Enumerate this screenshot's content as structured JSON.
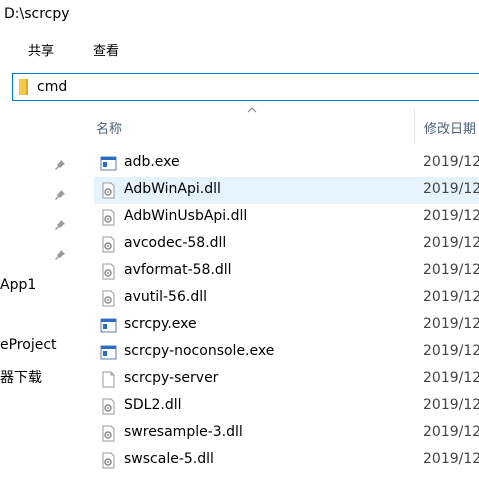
{
  "window": {
    "title": "D:\\scrcpy"
  },
  "ribbon": {
    "tabs": [
      "共享",
      "查看"
    ]
  },
  "address": {
    "value": "cmd"
  },
  "nav": {
    "items": [
      "App1",
      "eProject",
      "器下载"
    ]
  },
  "columns": {
    "name": "名称",
    "modified": "修改日期"
  },
  "files": [
    {
      "name": "adb.exe",
      "date": "2019/12",
      "type": "exe"
    },
    {
      "name": "AdbWinApi.dll",
      "date": "2019/12",
      "type": "dll",
      "selected": true
    },
    {
      "name": "AdbWinUsbApi.dll",
      "date": "2019/12",
      "type": "dll"
    },
    {
      "name": "avcodec-58.dll",
      "date": "2019/12",
      "type": "dll"
    },
    {
      "name": "avformat-58.dll",
      "date": "2019/12",
      "type": "dll"
    },
    {
      "name": "avutil-56.dll",
      "date": "2019/12",
      "type": "dll"
    },
    {
      "name": "scrcpy.exe",
      "date": "2019/12",
      "type": "exe"
    },
    {
      "name": "scrcpy-noconsole.exe",
      "date": "2019/12",
      "type": "exe"
    },
    {
      "name": "scrcpy-server",
      "date": "2019/12",
      "type": "file"
    },
    {
      "name": "SDL2.dll",
      "date": "2019/12",
      "type": "dll"
    },
    {
      "name": "swresample-3.dll",
      "date": "2019/12",
      "type": "dll"
    },
    {
      "name": "swscale-5.dll",
      "date": "2019/12",
      "type": "dll"
    }
  ],
  "colors": {
    "accent": "#0078d7",
    "selection": "#e5f3ff",
    "header_text": "#4c607a"
  }
}
